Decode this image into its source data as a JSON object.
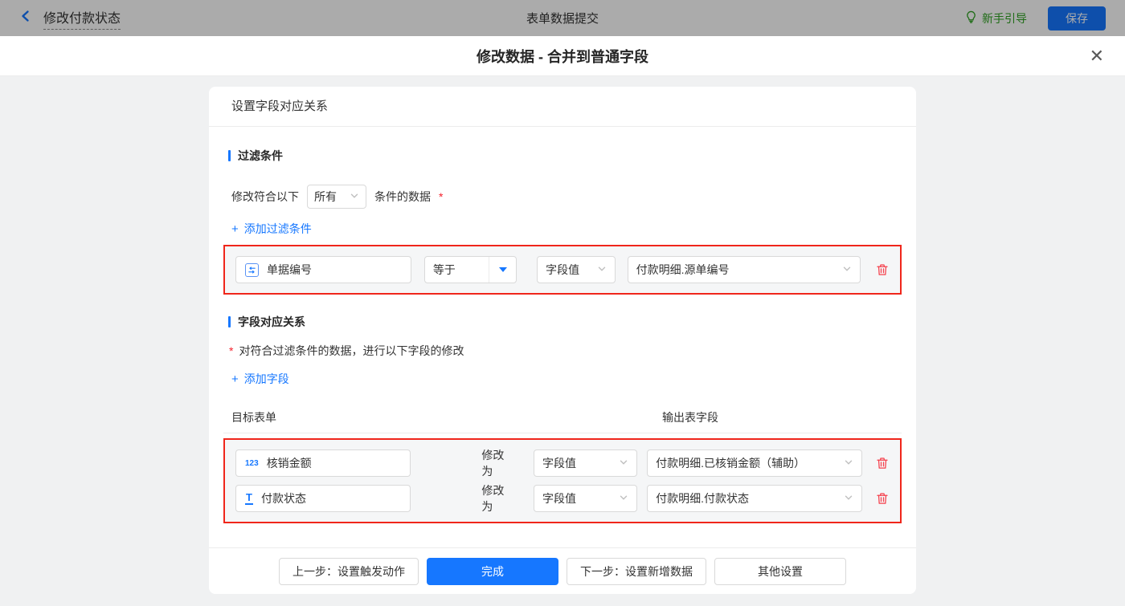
{
  "topbar": {
    "back_title": "修改付款状态",
    "center_title": "表单数据提交",
    "guide_label": "新手引导",
    "save_label": "保存"
  },
  "modal": {
    "title": "修改数据 - 合并到普通字段",
    "close_glyph": "✕"
  },
  "card": {
    "header": "设置字段对应关系",
    "filter_section": {
      "title": "过滤条件",
      "match_prefix": "修改符合以下",
      "match_select_value": "所有",
      "match_suffix": "条件的数据",
      "required_mark": "*",
      "add_link": "添加过滤条件",
      "add_plus": "+",
      "rows": [
        {
          "field_icon": "serial-number",
          "field": "单据编号",
          "operator": "等于",
          "value_type": "字段值",
          "value": "付款明细.源单编号"
        }
      ]
    },
    "mapping_section": {
      "title": "字段对应关系",
      "required_mark": "*",
      "description": "对符合过滤条件的数据，进行以下字段的修改",
      "add_link": "添加字段",
      "add_plus": "+",
      "col_target": "目标表单",
      "col_output": "输出表字段",
      "modify_label": "修改为",
      "rows": [
        {
          "field_icon": "123",
          "field": "核销金额",
          "value_type": "字段值",
          "value": "付款明细.已核销金额（辅助）"
        },
        {
          "field_icon": "T",
          "field": "付款状态",
          "value_type": "字段值",
          "value": "付款明细.付款状态"
        }
      ]
    },
    "footer": {
      "prev_label": "上一步：设置触发动作",
      "done_label": "完成",
      "next_label": "下一步：设置新增数据",
      "other_label": "其他设置"
    }
  },
  "colors": {
    "accent_blue": "#1677ff",
    "danger_red": "#f0261b",
    "trash_red": "#f5414d",
    "guide_green": "#2ea121",
    "required_red": "#f5222d"
  }
}
